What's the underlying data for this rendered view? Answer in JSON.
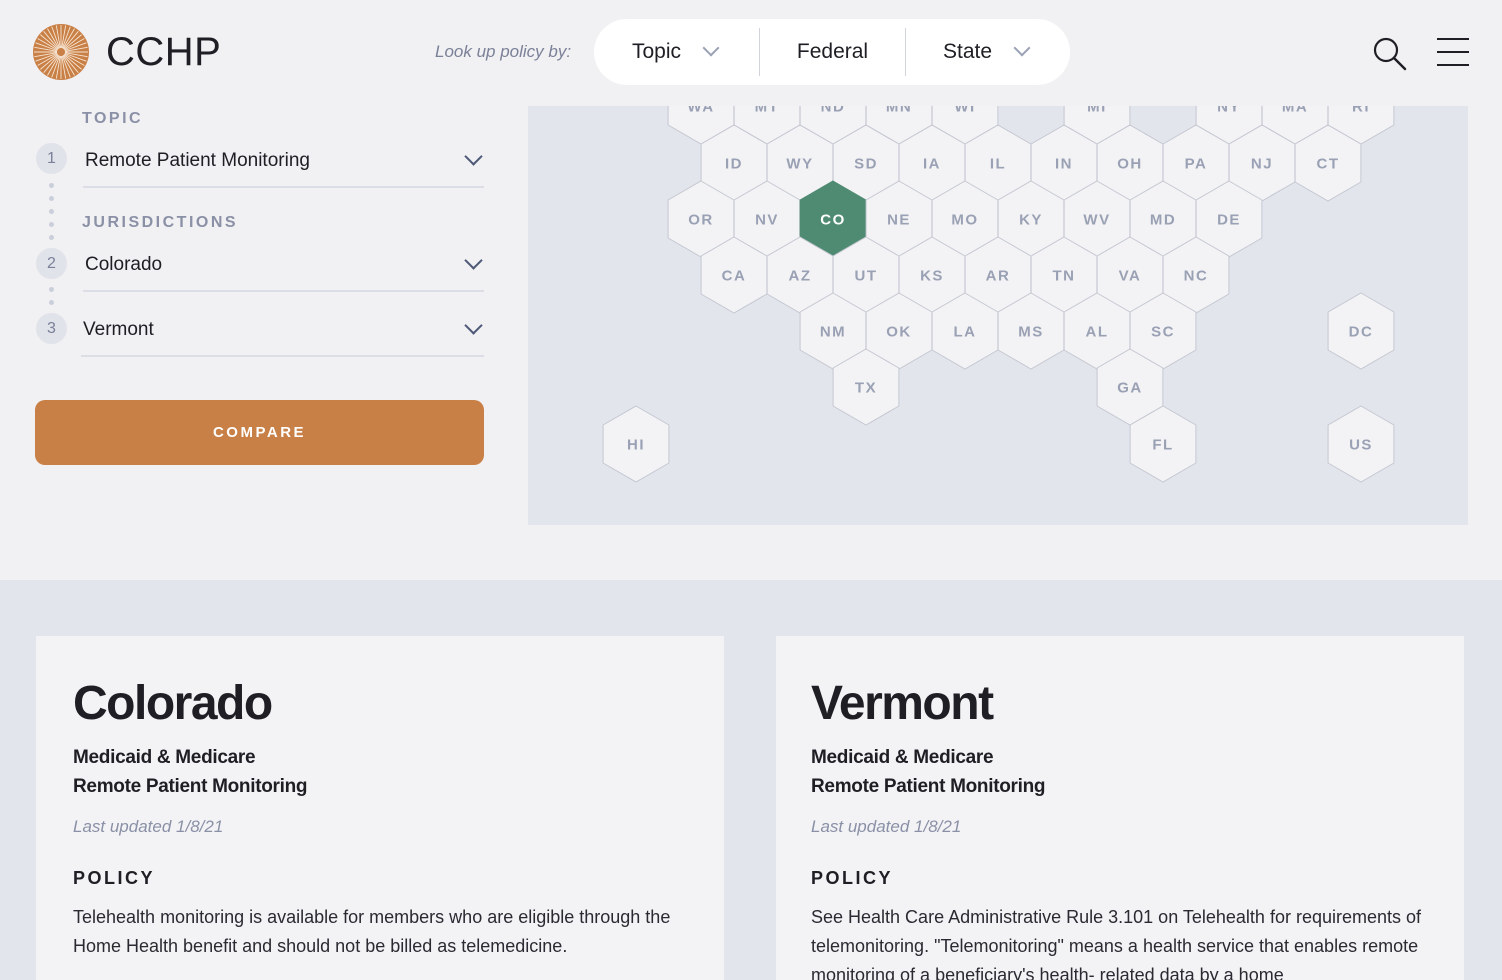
{
  "header": {
    "brand": "CCHP",
    "lookup_label": "Look up policy by:",
    "nav": {
      "topic": "Topic",
      "federal": "Federal",
      "state": "State"
    }
  },
  "sidebar": {
    "topic_label": "TOPIC",
    "topic_step": "1",
    "topic_value": "Remote Patient Monitoring",
    "jurisdictions_label": "JURISDICTIONS",
    "jurisdictions": [
      {
        "step": "2",
        "value": "Colorado"
      },
      {
        "step": "3",
        "value": "Vermont"
      }
    ],
    "compare_label": "COMPARE"
  },
  "map": {
    "selected": "CO",
    "selected_color": "#4f8a72",
    "rows": [
      [
        "WA",
        "MT",
        "ND",
        "MN",
        "WI",
        "MI",
        "NY",
        "MA",
        "RI"
      ],
      [
        "ID",
        "WY",
        "SD",
        "IA",
        "IL",
        "IN",
        "OH",
        "PA",
        "NJ",
        "CT"
      ],
      [
        "OR",
        "NV",
        "CO",
        "NE",
        "MO",
        "KY",
        "WV",
        "MD",
        "DE"
      ],
      [
        "CA",
        "AZ",
        "UT",
        "KS",
        "AR",
        "TN",
        "VA",
        "NC"
      ],
      [
        "NM",
        "OK",
        "LA",
        "MS",
        "AL",
        "SC",
        "DC"
      ],
      [
        "TX",
        "GA"
      ],
      [
        "HI",
        "FL",
        "US"
      ]
    ]
  },
  "cards": [
    {
      "title": "Colorado",
      "subtitle1": "Medicaid & Medicare",
      "subtitle2": "Remote Patient Monitoring",
      "updated": "Last updated 1/8/21",
      "policy_label": "POLICY",
      "body": "Telehealth monitoring is available for members who are eligible through the Home Health benefit and should not be billed as telemedicine."
    },
    {
      "title": "Vermont",
      "subtitle1": "Medicaid & Medicare",
      "subtitle2": "Remote Patient Monitoring",
      "updated": "Last updated 1/8/21",
      "policy_label": "POLICY",
      "body": "See Health Care Administrative Rule 3.101 on Telehealth for requirements of telemonitoring. \"Telemonitoring\" means a health service that enables remote monitoring of a beneficiary's health- related data by a home"
    }
  ],
  "colors": {
    "accent": "#c98046",
    "map_bg": "#e3e5ec",
    "hex_fill": "#f3f3f5",
    "hex_stroke": "#c5c8d2"
  }
}
